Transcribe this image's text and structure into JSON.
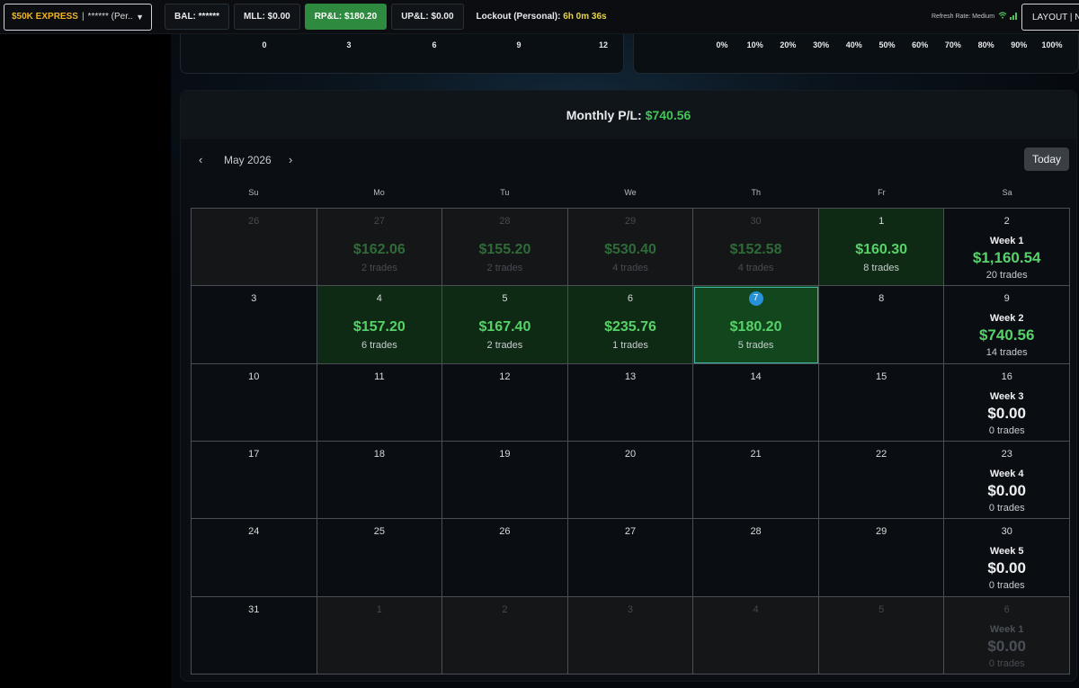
{
  "topbar": {
    "account_name": "$50K EXPRESS",
    "account_sep": "|",
    "account_masked": "****** (Per...",
    "balance": "BAL: ******",
    "mll": "MLL: $0.00",
    "rpl": "RP&L: $180.20",
    "upl": "UP&L: $0.00",
    "lockout_label": "Lockout (Personal):",
    "lockout_value": "6h 0m 36s",
    "refresh_rate": "Refresh Rate: Medium",
    "layout_button": "LAYOUT | NE"
  },
  "panel_a_ticks": [
    "0",
    "3",
    "6",
    "9",
    "12"
  ],
  "panel_b_ticks": [
    "0%",
    "10%",
    "20%",
    "30%",
    "40%",
    "50%",
    "60%",
    "70%",
    "80%",
    "90%",
    "100%"
  ],
  "calendar": {
    "header_label": "Monthly P/L:",
    "header_value": "$740.56",
    "month": "May 2026",
    "prev": "‹",
    "next": "›",
    "today_button": "Today",
    "weekdays": [
      "Su",
      "Mo",
      "Tu",
      "We",
      "Th",
      "Fr",
      "Sa"
    ],
    "weeks": [
      [
        {
          "day": "26",
          "muted": true
        },
        {
          "day": "27",
          "muted": true,
          "amount": "$162.06",
          "trades": "2 trades"
        },
        {
          "day": "28",
          "muted": true,
          "amount": "$155.20",
          "trades": "2 trades"
        },
        {
          "day": "29",
          "muted": true,
          "amount": "$530.40",
          "trades": "4 trades"
        },
        {
          "day": "30",
          "muted": true,
          "amount": "$152.58",
          "trades": "4 trades"
        },
        {
          "day": "1",
          "positive": true,
          "amount": "$160.30",
          "trades": "8 trades"
        },
        {
          "day": "2",
          "week_label": "Week 1",
          "week_amount": "$1,160.54",
          "week_trades": "20 trades",
          "week_positive": true
        }
      ],
      [
        {
          "day": "3"
        },
        {
          "day": "4",
          "positive": true,
          "amount": "$157.20",
          "trades": "6 trades"
        },
        {
          "day": "5",
          "positive": true,
          "amount": "$167.40",
          "trades": "2 trades"
        },
        {
          "day": "6",
          "positive": true,
          "amount": "$235.76",
          "trades": "1 trades"
        },
        {
          "day": "7",
          "selected": true,
          "today": true,
          "amount": "$180.20",
          "trades": "5 trades"
        },
        {
          "day": "8"
        },
        {
          "day": "9",
          "week_label": "Week 2",
          "week_amount": "$740.56",
          "week_trades": "14 trades",
          "week_positive": true
        }
      ],
      [
        {
          "day": "10"
        },
        {
          "day": "11"
        },
        {
          "day": "12"
        },
        {
          "day": "13"
        },
        {
          "day": "14"
        },
        {
          "day": "15"
        },
        {
          "day": "16",
          "week_label": "Week 3",
          "week_amount": "$0.00",
          "week_trades": "0 trades"
        }
      ],
      [
        {
          "day": "17"
        },
        {
          "day": "18"
        },
        {
          "day": "19"
        },
        {
          "day": "20"
        },
        {
          "day": "21"
        },
        {
          "day": "22"
        },
        {
          "day": "23",
          "week_label": "Week 4",
          "week_amount": "$0.00",
          "week_trades": "0 trades"
        }
      ],
      [
        {
          "day": "24"
        },
        {
          "day": "25"
        },
        {
          "day": "26"
        },
        {
          "day": "27"
        },
        {
          "day": "28"
        },
        {
          "day": "29"
        },
        {
          "day": "30",
          "week_label": "Week 5",
          "week_amount": "$0.00",
          "week_trades": "0 trades"
        }
      ],
      [
        {
          "day": "31"
        },
        {
          "day": "1",
          "muted": true
        },
        {
          "day": "2",
          "muted": true
        },
        {
          "day": "3",
          "muted": true
        },
        {
          "day": "4",
          "muted": true
        },
        {
          "day": "5",
          "muted": true
        },
        {
          "day": "6",
          "muted": true,
          "week_label": "Week 1",
          "week_amount": "$0.00",
          "week_trades": "0 trades"
        }
      ]
    ]
  }
}
